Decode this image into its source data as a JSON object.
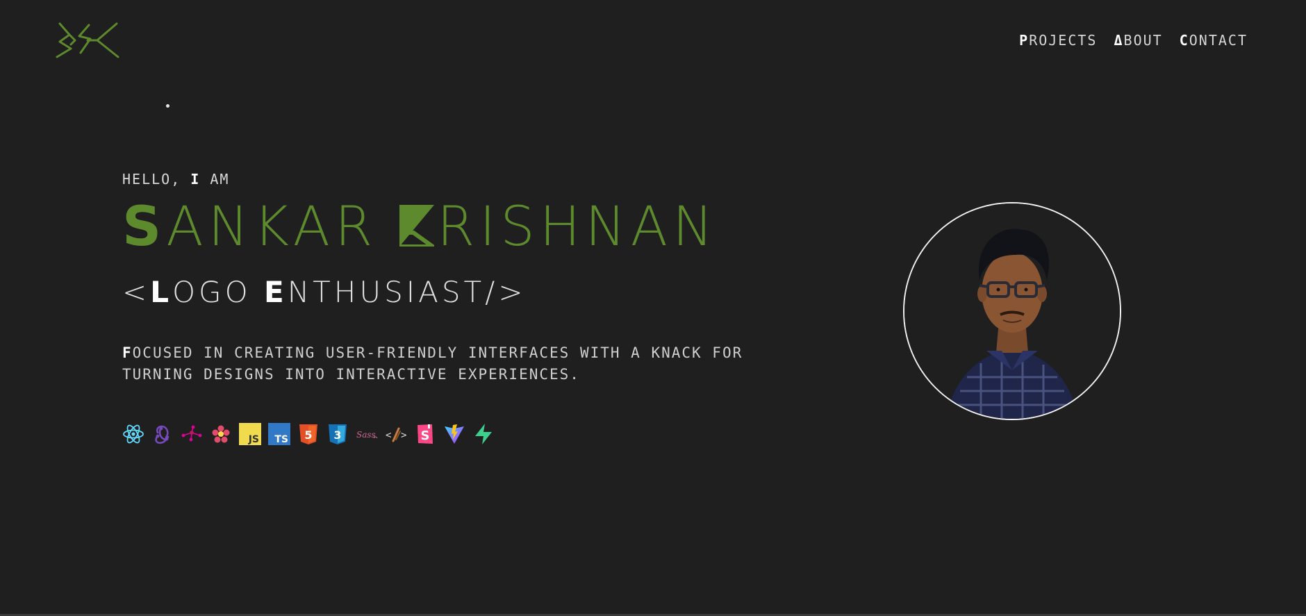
{
  "brand": {
    "logo": "SSK"
  },
  "nav": [
    {
      "first": "P",
      "rest": "ROJECTS"
    },
    {
      "first": "Δ",
      "rest": "BOUT"
    },
    {
      "first": "C",
      "rest": "ONTACT"
    }
  ],
  "hero": {
    "greeting_first": "H",
    "greeting_mid": "ELLO, ",
    "greeting_i": "I",
    "greeting_rest": " AM",
    "name_first": "S",
    "name_rest1": "ANKAR ",
    "name_rest2": "RISHNAN",
    "role_open": "<",
    "role_l": "L",
    "role_ogo": "OGO ",
    "role_e": "E",
    "role_rest": "NTHUSIAST/>",
    "desc_first": "F",
    "desc_rest": "OCUSED IN CREATING USER-FRIENDLY INTERFACES WITH A KNACK FOR TURNING DESIGNS INTO INTERACTIVE EXPERIENCES."
  },
  "tech_icons": [
    "react-icon",
    "redux-icon",
    "graphql-icon",
    "recoil-icon",
    "javascript-icon",
    "typescript-icon",
    "html5-icon",
    "css3-icon",
    "sass-icon",
    "jsx-icon",
    "storybook-icon",
    "vite-icon",
    "supabase-icon"
  ],
  "colors": {
    "background": "#1f1f1f",
    "accent": "#5e8a2e",
    "text": "#d9d9d9"
  }
}
